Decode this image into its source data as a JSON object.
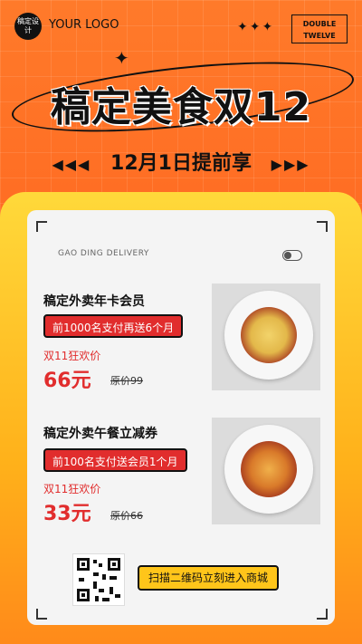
{
  "brand": {
    "logo_badge": "稿定设计",
    "logo_text": "YOUR LOGO",
    "double_twelve": [
      "DOUBLE",
      "TWELVE"
    ]
  },
  "headline": {
    "title": "稿定美食双12",
    "subtitle": "12月1日提前享"
  },
  "panel": {
    "label": "GAO DING DELIVERY"
  },
  "items": [
    {
      "title": "稿定外卖年卡会员",
      "offer": "前1000名支付再送6个月",
      "promo": "双11狂欢价",
      "price": "66元",
      "original": "原价99"
    },
    {
      "title": "稿定外卖午餐立减券",
      "offer": "前100名支付送会员1个月",
      "promo": "双11狂欢价",
      "price": "33元",
      "original": "原价66"
    }
  ],
  "cta": {
    "scan_label": "扫描二维码立刻进入商城"
  },
  "colors": {
    "accent_orange": "#ff6a22",
    "accent_yellow": "#ffc51a",
    "accent_red": "#e12d2d"
  }
}
